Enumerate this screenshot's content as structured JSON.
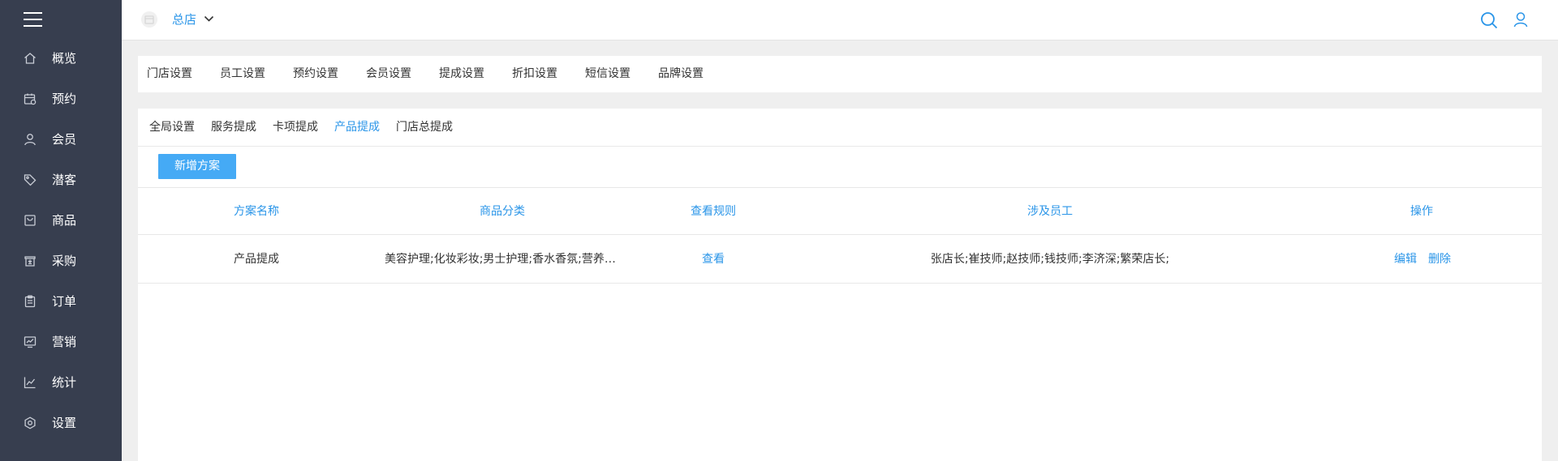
{
  "sidebar": {
    "menu_icon": "hamburger-menu-icon",
    "items": [
      {
        "label": "概览",
        "icon": "home-icon"
      },
      {
        "label": "预约",
        "icon": "calendar-icon"
      },
      {
        "label": "会员",
        "icon": "user-icon"
      },
      {
        "label": "潜客",
        "icon": "tag-icon"
      },
      {
        "label": "商品",
        "icon": "bag-icon"
      },
      {
        "label": "采购",
        "icon": "purchase-icon"
      },
      {
        "label": "订单",
        "icon": "clipboard-icon"
      },
      {
        "label": "营销",
        "icon": "marketing-icon"
      },
      {
        "label": "统计",
        "icon": "chart-line-icon"
      },
      {
        "label": "设置",
        "icon": "gear-icon"
      }
    ]
  },
  "topbar": {
    "store_name": "总店",
    "icons": [
      "store-icon",
      "chevron-down-icon",
      "search-icon",
      "user-icon"
    ]
  },
  "settings_tabs": [
    "门店设置",
    "员工设置",
    "预约设置",
    "会员设置",
    "提成设置",
    "折扣设置",
    "短信设置",
    "品牌设置"
  ],
  "subtabs": {
    "items": [
      "全局设置",
      "服务提成",
      "卡项提成",
      "产品提成",
      "门店总提成"
    ],
    "active_index": 3
  },
  "toolbar": {
    "add_label": "新增方案"
  },
  "table": {
    "headers": [
      "方案名称",
      "商品分类",
      "查看规则",
      "涉及员工",
      "操作"
    ],
    "rows": [
      {
        "name": "产品提成",
        "category": "美容护理;化妆彩妆;男士护理;香水香氛;营养保健;",
        "rule_link": "查看",
        "staff": "张店长;崔技师;赵技师;钱技师;李济深;繁荣店长;",
        "edit_label": "编辑",
        "delete_label": "删除"
      }
    ]
  },
  "colors": {
    "sidebar_bg": "#373e4f",
    "accent": "#2a95e8",
    "button_bg": "#45aaf5",
    "page_bg": "#efefef"
  }
}
